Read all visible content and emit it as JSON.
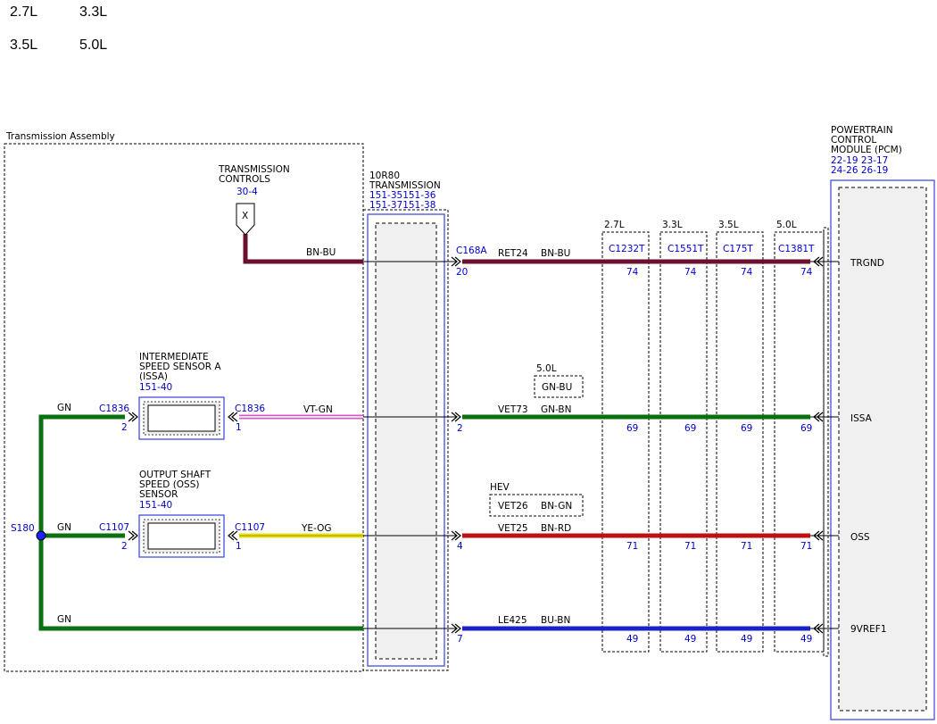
{
  "engine_options": [
    [
      "2.7L",
      "3.3L"
    ],
    [
      "3.5L",
      "5.0L"
    ]
  ],
  "colors": {
    "wire_gn": "#0a7010",
    "wire_rd": "#bb1111",
    "wire_bu": "#1a22c8",
    "wire_bn_bu": "#6a1030",
    "wire_vt_gn": "#d060c0",
    "wire_ye_og": "#e8e010",
    "component_outline": "#3340e0",
    "component_fill": "#f0f0f0",
    "link_text": "#0000cc"
  },
  "assembly": {
    "label": "Transmission Assembly"
  },
  "transmission_controls": {
    "title_line1": "TRANSMISSION",
    "title_line2": "CONTROLS",
    "ref": "30-4",
    "terminal_symbol": "X",
    "wire_color": "BN-BU"
  },
  "trans_10r80": {
    "line1": "10R80",
    "line2": "TRANSMISSION",
    "ref1": "151-35151-36",
    "ref2": "151-37151-38"
  },
  "issa": {
    "line1": "INTERMEDIATE",
    "line2": "SPEED SENSOR A",
    "line3": "(ISSA)",
    "ref": "151-40",
    "left_connector": "C1836",
    "left_pin": "2",
    "right_connector": "C1836",
    "right_pin": "1",
    "left_wire": "GN",
    "right_wire": "VT-GN"
  },
  "oss": {
    "line1": "OUTPUT SHAFT",
    "line2": "SPEED (OSS)",
    "line3": "SENSOR",
    "ref": "151-40",
    "left_connector": "C1107",
    "left_pin": "2",
    "right_connector": "C1107",
    "right_pin": "1",
    "left_wire": "GN",
    "right_wire": "YE-OG"
  },
  "splice": {
    "label": "S180"
  },
  "bottom_wire": {
    "color": "GN"
  },
  "connector_c168a": {
    "name": "C168A",
    "pins": [
      "20",
      "2",
      "4",
      "7"
    ]
  },
  "circuits": [
    {
      "circuit": "RET24",
      "color": "BN-BU"
    },
    {
      "circuit": "VET73",
      "color": "GN-BN"
    },
    {
      "circuit": "VET25",
      "color": "BN-RD"
    },
    {
      "circuit": "LE425",
      "color": "BU-BN"
    }
  ],
  "alt_boxes": [
    {
      "label": "5.0L",
      "color": "GN-BU"
    },
    {
      "label": "HEV",
      "circuit": "VET26",
      "color": "BN-GN"
    }
  ],
  "pcm_connectors": [
    {
      "engine": "2.7L",
      "connector": "C1232T",
      "pins": [
        "74",
        "69",
        "71",
        "49"
      ]
    },
    {
      "engine": "3.3L",
      "connector": "C1551T",
      "pins": [
        "74",
        "69",
        "71",
        "49"
      ]
    },
    {
      "engine": "3.5L",
      "connector": "C175T",
      "pins": [
        "74",
        "69",
        "71",
        "49"
      ]
    },
    {
      "engine": "5.0L",
      "connector": "C1381T",
      "pins": [
        "74",
        "69",
        "71",
        "49"
      ]
    }
  ],
  "pcm": {
    "line1": "POWERTRAIN",
    "line2": "CONTROL",
    "line3": "MODULE (PCM)",
    "ref_line1": "22-19 23-17",
    "ref_line2": "24-26 26-19",
    "signals": [
      "TRGND",
      "ISSA",
      "OSS",
      "9VREF1"
    ]
  }
}
